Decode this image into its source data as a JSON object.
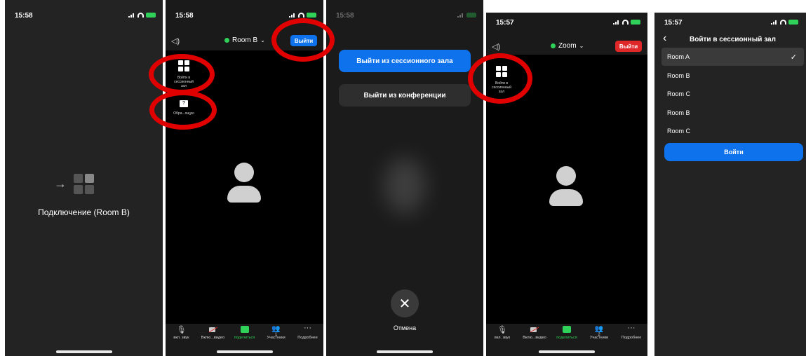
{
  "p1": {
    "time": "15:58",
    "connecting": "Подключение (Room B)"
  },
  "p2": {
    "time": "15:58",
    "room": "Room B",
    "leave": "Выйти",
    "side": [
      {
        "label": "Войти в сессионный зал"
      },
      {
        "label": "Обра...ощую"
      }
    ],
    "toolbar": [
      "вкл. звук",
      "Вклю...видео",
      "поделиться",
      "Участники",
      "Подробнее"
    ],
    "participants_count": "1"
  },
  "p3": {
    "time": "15:58",
    "leave_breakout": "Выйти из сессионного зала",
    "leave_meeting": "Выйти из конференции",
    "cancel": "Отмена"
  },
  "p4": {
    "time": "15:57",
    "room": "Zoom",
    "leave": "Выйти",
    "side": [
      {
        "label": "Войти в сессионный зал"
      }
    ],
    "toolbar": [
      "вкл. звук",
      "Вклю...видео",
      "поделиться",
      "Участники",
      "Подробнее"
    ],
    "participants_count": "2"
  },
  "p5": {
    "time": "15:57",
    "title": "Войти в сессионный зал",
    "rooms": [
      "Room A",
      "Room B",
      "Room C",
      "Room B",
      "Room C"
    ],
    "selected_index": 0,
    "join": "Войти"
  },
  "colors": {
    "accent": "#0e72ed",
    "leave_red": "#e02828",
    "green": "#30d158",
    "ring": "#e00000"
  }
}
